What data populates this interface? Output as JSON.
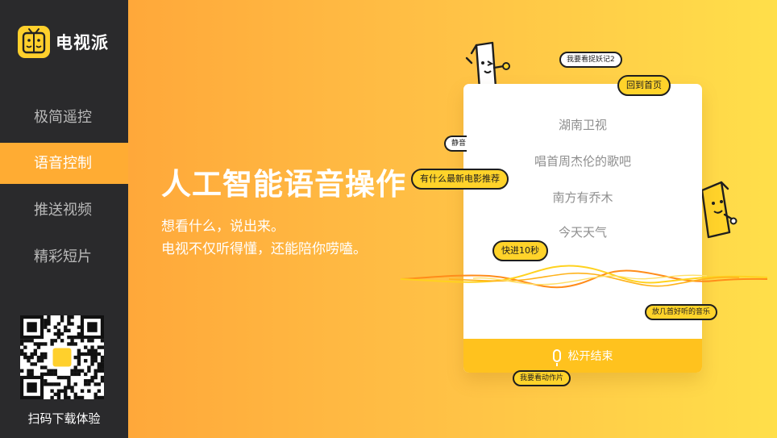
{
  "app": {
    "name": "电视派"
  },
  "sidebar": {
    "items": [
      {
        "label": "极简遥控",
        "active": false
      },
      {
        "label": "语音控制",
        "active": true
      },
      {
        "label": "推送视频",
        "active": false
      },
      {
        "label": "精彩短片",
        "active": false
      }
    ],
    "qr_caption": "扫码下载体验"
  },
  "main": {
    "headline": "人工智能语音操作",
    "subtitle_line1": "想看什么，说出来。",
    "subtitle_line2": "电视不仅听得懂，还能陪你唠嗑。",
    "card": {
      "lines": [
        "湖南卫视",
        "唱首周杰伦的歌吧",
        "南方有乔木",
        "今天天气"
      ],
      "footer_label": "松开结束",
      "footer_icon": "microphone-icon"
    },
    "bubbles": {
      "b1": "我要看捉妖记2",
      "b2": "回到首页",
      "b3": "静音",
      "b4": "有什么最新电影推荐",
      "b5": "快进10秒",
      "b6": "放几首好听的音乐",
      "b7": "我要看动作片"
    }
  },
  "colors": {
    "sidebar_bg": "#2a2a2c",
    "active_item": "#ffac33",
    "brand_yellow": "#ffd02c",
    "gradient_start": "#ffa83a",
    "gradient_end": "#ffdf4a",
    "wave_orange": "#ff8c1a",
    "wave_yellow": "#ffd21f"
  }
}
